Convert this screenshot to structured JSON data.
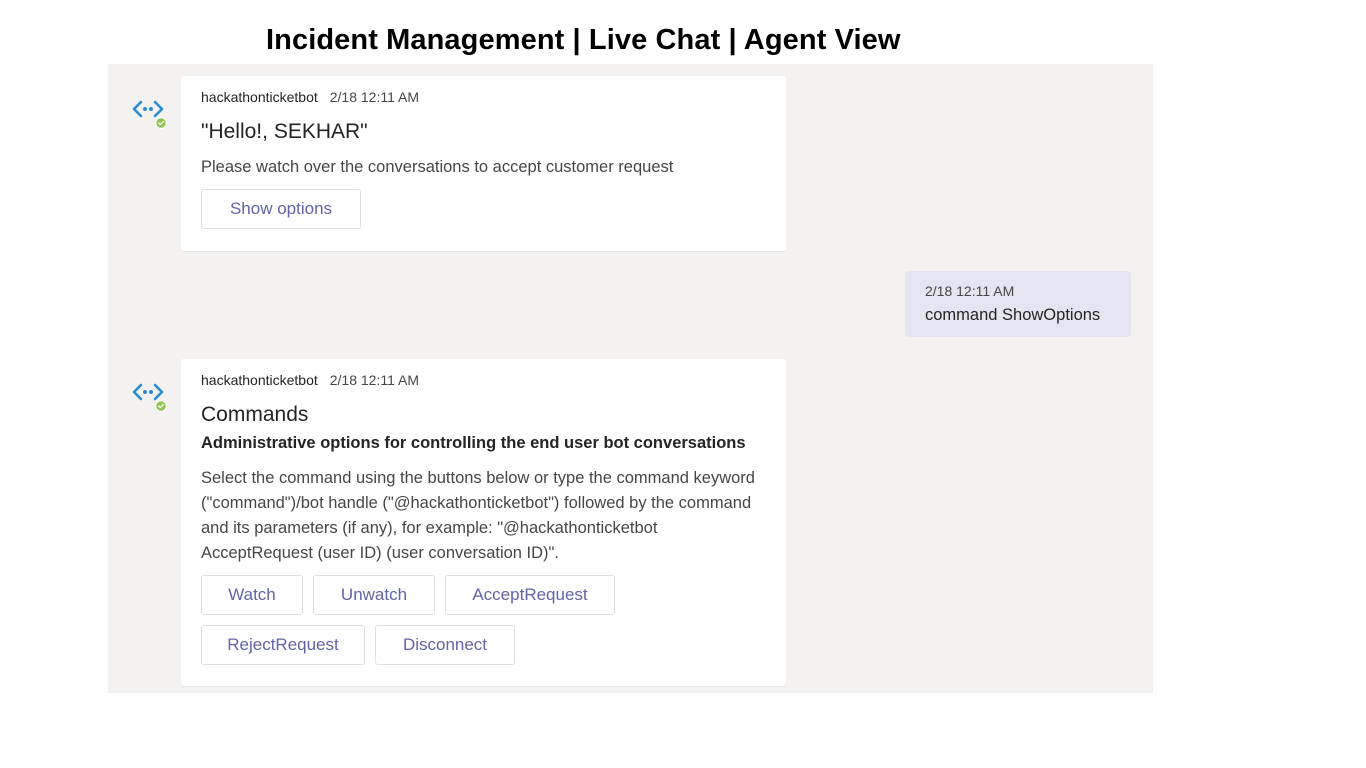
{
  "page": {
    "title": "Incident Management | Live Chat | Agent View"
  },
  "colors": {
    "pane_bg": "#f3f2f1",
    "accent": "#6264a7",
    "bot_icon": "#2a8dd4",
    "presence": "#92c353",
    "user_bubble": "#e5e5f1"
  },
  "messages": [
    {
      "type": "bot",
      "sender": "hackathonticketbot",
      "time": "2/18 12:11 AM",
      "heading": "\"Hello!, SEKHAR\"",
      "text": "Please watch over the conversations to accept customer request",
      "buttons": [
        "Show options"
      ],
      "avatar_icon": "bot-icon"
    },
    {
      "type": "user",
      "time": "2/18 12:11 AM",
      "text": "command ShowOptions"
    },
    {
      "type": "bot",
      "sender": "hackathonticketbot",
      "time": "2/18 12:11 AM",
      "heading": "Commands",
      "subheading": "Administrative options for controlling the end user bot conversations",
      "text": "Select the command using the buttons below or type the command keyword (\"command\")/bot handle (\"@hackathonticketbot\") followed by the command and its parameters (if any), for example: \"@hackathonticketbot AcceptRequest (user ID) (user conversation ID)\".",
      "buttons": [
        "Watch",
        "Unwatch",
        "AcceptRequest",
        "RejectRequest",
        "Disconnect"
      ],
      "avatar_icon": "bot-icon"
    }
  ]
}
